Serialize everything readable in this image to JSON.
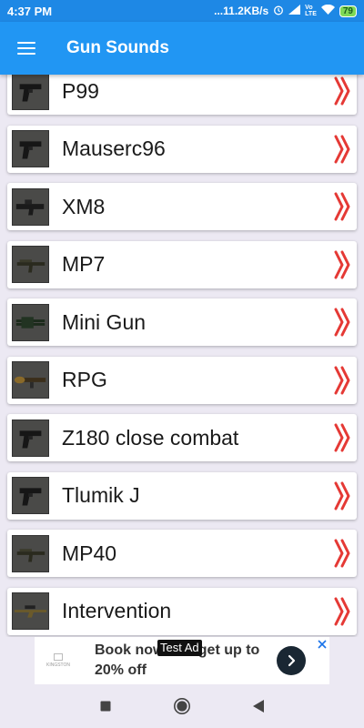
{
  "status_bar": {
    "time": "4:37 PM",
    "network_speed": "...11.2KB/s",
    "carrier_tag_top": "Vo",
    "carrier_tag_bottom": "LTE",
    "battery": "79"
  },
  "app_bar": {
    "title": "Gun Sounds",
    "menu_icon": "hamburger-menu-icon"
  },
  "guns": [
    {
      "label": "P99",
      "icon": "pistol-thumbnail"
    },
    {
      "label": "Mauserc96",
      "icon": "pistol-thumbnail"
    },
    {
      "label": "XM8",
      "icon": "rifle-thumbnail"
    },
    {
      "label": "MP7",
      "icon": "smg-thumbnail"
    },
    {
      "label": "Mini Gun",
      "icon": "minigun-thumbnail"
    },
    {
      "label": "RPG",
      "icon": "rocket-launcher-thumbnail"
    },
    {
      "label": "Z180 close combat",
      "icon": "pistol-thumbnail"
    },
    {
      "label": "Tlumik J",
      "icon": "pistol-thumbnail"
    },
    {
      "label": "MP40",
      "icon": "smg-thumbnail"
    },
    {
      "label": "Intervention",
      "icon": "sniper-thumbnail"
    }
  ],
  "row_chevron_icon": "double-chevron-right-icon",
  "row_chevron_color": "#e53935",
  "ad": {
    "logo_text": "KINGSTON",
    "headline": "Book now and get up to 20% off",
    "badge": "Test Ad",
    "arrow_icon": "arrow-right-icon",
    "close_icon": "ad-choices-close-icon"
  },
  "nav_bar": {
    "recents_icon": "square-recents-icon",
    "home_icon": "circle-home-icon",
    "back_icon": "triangle-back-icon"
  },
  "colors": {
    "app_bar": "#2196f3",
    "status_bar": "#1e88e5",
    "background": "#ece9f3",
    "chevron": "#e53935"
  }
}
